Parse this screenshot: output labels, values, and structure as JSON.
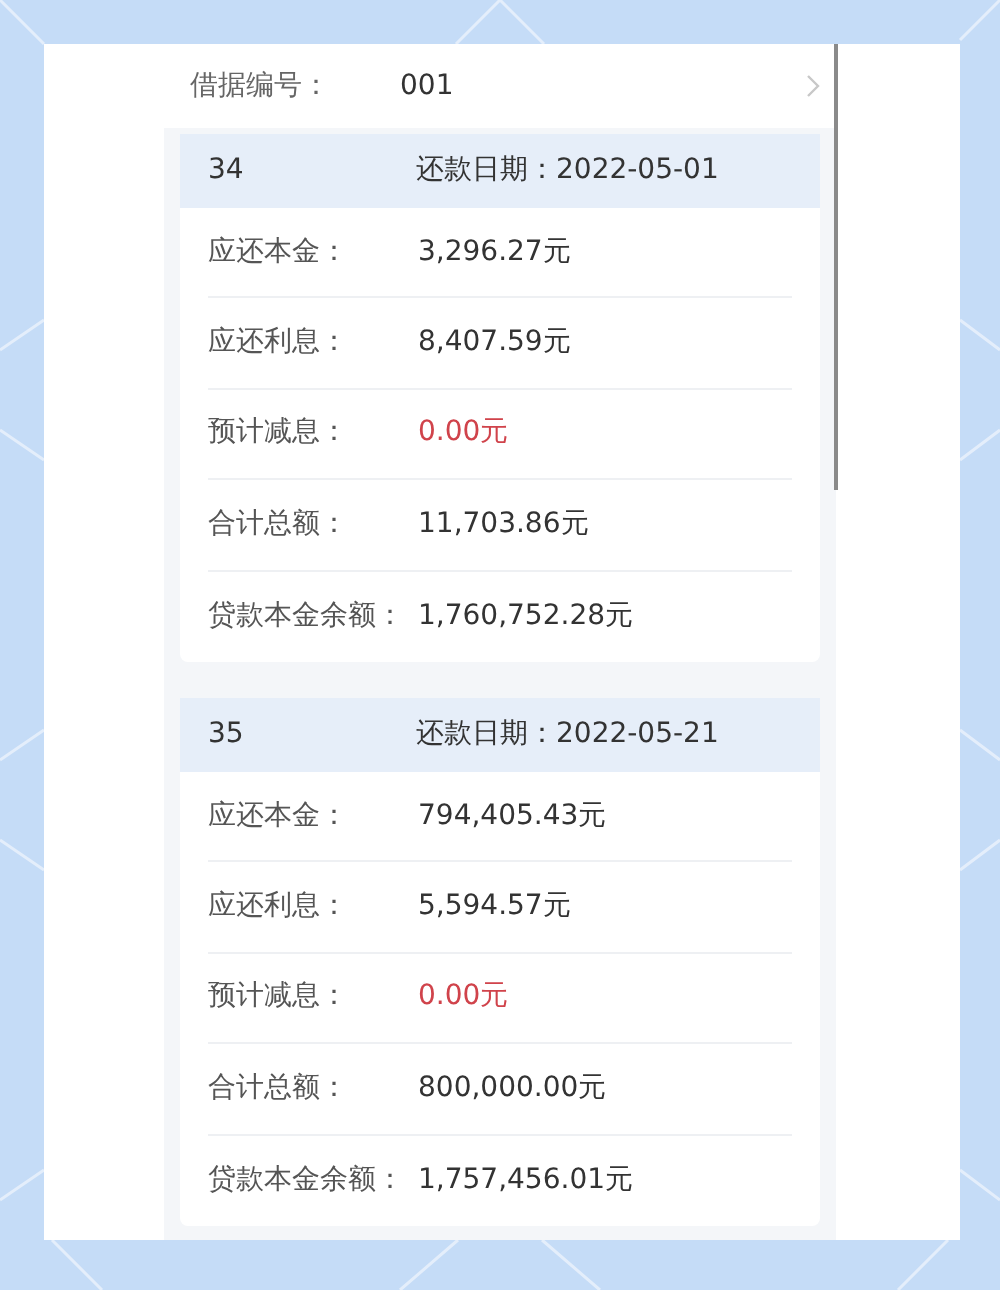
{
  "header": {
    "label": "借据编号：",
    "value": "001"
  },
  "installments": [
    {
      "number": "34",
      "date_label": "还款日期：",
      "date": "2022-05-01",
      "rows": [
        {
          "kind": "normal",
          "label": "应还本金：",
          "value": "3,296.27元"
        },
        {
          "kind": "normal",
          "label": "应还利息：",
          "value": "8,407.59元"
        },
        {
          "kind": "reduction",
          "label": "预计减息：",
          "value": "0.00元"
        },
        {
          "kind": "normal",
          "label": "合计总额：",
          "value": "11,703.86元"
        },
        {
          "kind": "normal",
          "label": "贷款本金余额：",
          "value": "1,760,752.28元"
        }
      ]
    },
    {
      "number": "35",
      "date_label": "还款日期：",
      "date": "2022-05-21",
      "rows": [
        {
          "kind": "normal",
          "label": "应还本金：",
          "value": "794,405.43元"
        },
        {
          "kind": "normal",
          "label": "应还利息：",
          "value": "5,594.57元"
        },
        {
          "kind": "reduction",
          "label": "预计减息：",
          "value": "0.00元"
        },
        {
          "kind": "normal",
          "label": "合计总额：",
          "value": "800,000.00元"
        },
        {
          "kind": "normal",
          "label": "贷款本金余额：",
          "value": "1,757,456.01元"
        }
      ]
    }
  ]
}
